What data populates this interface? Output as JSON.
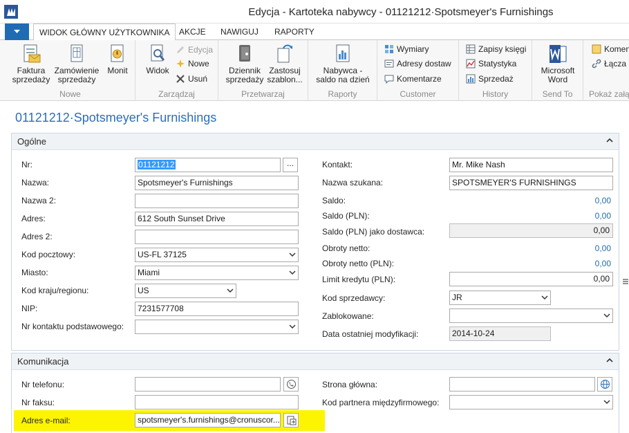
{
  "window": {
    "title": "Edycja - Kartoteka nabywcy - 01121212·Spotsmeyer's Furnishings"
  },
  "tabs": [
    {
      "label": "WIDOK GŁÓWNY UŻYTKOWNIKA",
      "active": true
    },
    {
      "label": "AKCJE"
    },
    {
      "label": "NAWIGUJ"
    },
    {
      "label": "RAPORTY"
    }
  ],
  "ribbon": {
    "groups": {
      "nowe": "Nowe",
      "zarzadzaj": "Zarządzaj",
      "przetwarzaj": "Przetwarzaj",
      "raporty": "Raporty",
      "customer": "Customer",
      "history": "History",
      "sendto": "Send To",
      "pokaz": "Pokaż załą"
    },
    "buttons": {
      "faktura_1": "Faktura",
      "faktura_2": "sprzedaży",
      "zamowienie_1": "Zamówienie",
      "zamowienie_2": "sprzedaży",
      "monit": "Monit",
      "widok": "Widok",
      "edycja": "Edycja",
      "nowe": "Nowe",
      "usun": "Usuń",
      "dziennik_1": "Dziennik",
      "dziennik_2": "sprzedaży",
      "zastosuj_1": "Zastosuj",
      "zastosuj_2": "szablon...",
      "nabywca_1": "Nabywca -",
      "nabywca_2": "saldo na dzień",
      "wymiary": "Wymiary",
      "adresy_dostaw": "Adresy dostaw",
      "komentarze": "Komentarze",
      "zapisy_ksiegi": "Zapisy księgi",
      "statystyka": "Statystyka",
      "sprzedaz": "Sprzedaż",
      "word_1": "Microsoft",
      "word_2": "Word",
      "komentarz": "Komen",
      "lacza": "Łącza"
    }
  },
  "page_title": "01121212·Spotsmeyer's Furnishings",
  "ogolne": {
    "title": "Ogólne",
    "left": {
      "nr": {
        "label": "Nr:",
        "value": "01121212"
      },
      "nazwa": {
        "label": "Nazwa:",
        "value": "Spotsmeyer's Furnishings"
      },
      "nazwa2": {
        "label": "Nazwa 2:",
        "value": ""
      },
      "adres": {
        "label": "Adres:",
        "value": "612 South Sunset Drive"
      },
      "adres2": {
        "label": "Adres 2:",
        "value": ""
      },
      "kod_pocztowy": {
        "label": "Kod pocztowy:",
        "value": "US-FL 37125"
      },
      "miasto": {
        "label": "Miasto:",
        "value": "Miami"
      },
      "kod_kraju": {
        "label": "Kod kraju/regionu:",
        "value": "US"
      },
      "nip": {
        "label": "NIP:",
        "value": "7231577708"
      },
      "nr_kontaktu": {
        "label": "Nr kontaktu podstawowego:",
        "value": ""
      }
    },
    "right": {
      "kontakt": {
        "label": "Kontakt:",
        "value": "Mr. Mike Nash"
      },
      "nazwa_szukana": {
        "label": "Nazwa szukana:",
        "value": "SPOTSMEYER'S FURNISHINGS"
      },
      "saldo": {
        "label": "Saldo:",
        "value": "0,00"
      },
      "saldo_pln": {
        "label": "Saldo (PLN):",
        "value": "0,00"
      },
      "saldo_dostawca": {
        "label": "Saldo (PLN) jako dostawca:",
        "value": "0,00"
      },
      "obroty": {
        "label": "Obroty netto:",
        "value": "0,00"
      },
      "obroty_pln": {
        "label": "Obroty netto (PLN):",
        "value": "0,00"
      },
      "limit": {
        "label": "Limit kredytu (PLN):",
        "value": "0,00"
      },
      "kod_sprzedawcy": {
        "label": "Kod sprzedawcy:",
        "value": "JR"
      },
      "zablokowane": {
        "label": "Zablokowane:",
        "value": ""
      },
      "data_modyfikacji": {
        "label": "Data ostatniej modyfikacji:",
        "value": "2014-10-24"
      }
    }
  },
  "komunikacja": {
    "title": "Komunikacja",
    "nr_telefonu": {
      "label": "Nr telefonu:",
      "value": ""
    },
    "nr_faksu": {
      "label": "Nr faksu:",
      "value": ""
    },
    "email": {
      "label": "Adres e-mail:",
      "value": "spotsmeyer's.furnishings@cronuscor..."
    },
    "strona": {
      "label": "Strona główna:",
      "value": ""
    },
    "kod_partnera": {
      "label": "Kod partnera międzyfirmowego:",
      "value": ""
    }
  },
  "colors": {
    "accent": "#2a6ebb",
    "highlight": "#fcf400",
    "file_button": "#1f6cb3"
  }
}
